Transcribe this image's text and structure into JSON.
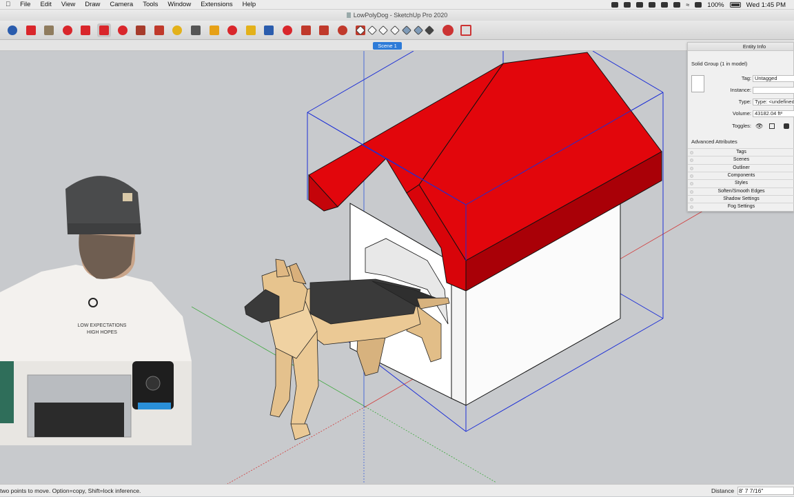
{
  "app": {
    "menu": [
      "File",
      "Edit",
      "View",
      "Draw",
      "Camera",
      "Tools",
      "Window",
      "Extensions",
      "Help"
    ],
    "window_title": "LowPolyDog - SketchUp Pro 2020",
    "status": {
      "battery_pct": "100%",
      "clock": "Wed 1:45 PM"
    }
  },
  "toolbar": {
    "tools": [
      {
        "name": "select-tool",
        "color": "#2a5cad",
        "active": false
      },
      {
        "name": "lasso-select-tool",
        "color": "#d9262b",
        "active": false
      },
      {
        "name": "paint-bucket-tool",
        "color": "#8f7c5e",
        "active": false
      },
      {
        "name": "push-pull-tool",
        "color": "#d9262b",
        "active": false
      },
      {
        "name": "rotate-tool",
        "color": "#d9262b",
        "active": false
      },
      {
        "name": "move-tool",
        "color": "#d9262b",
        "active": true
      },
      {
        "name": "follow-me-tool",
        "color": "#d9262b",
        "active": false
      },
      {
        "name": "offset-tool",
        "color": "#a63b2b",
        "active": false
      },
      {
        "name": "scale-tool",
        "color": "#c0392b",
        "active": false
      },
      {
        "name": "tape-measure-tool",
        "color": "#e3b11a",
        "active": false
      },
      {
        "name": "text-tool",
        "color": "#555555",
        "active": false
      },
      {
        "name": "orbit-tool",
        "color": "#e6a016",
        "active": false
      },
      {
        "name": "pan-tool",
        "color": "#d9262b",
        "active": false
      },
      {
        "name": "hand-tool",
        "color": "#e3b11a",
        "active": false
      },
      {
        "name": "zoom-tool",
        "color": "#2a5cad",
        "active": false
      },
      {
        "name": "zoom-extents-tool",
        "color": "#d9262b",
        "active": false
      },
      {
        "name": "warehouse-tool",
        "color": "#c0392b",
        "active": false
      },
      {
        "name": "extension-tool",
        "color": "#c0392b",
        "active": false
      },
      {
        "name": "component-tool",
        "color": "#c0392b",
        "active": false
      },
      {
        "name": "ruby-tool",
        "color": "#c0392b",
        "active": false
      }
    ],
    "styles": [
      "xray-style",
      "back-edges-style",
      "wireframe-style",
      "hidden-line-style",
      "shaded-style",
      "shaded-textures-style",
      "monochrome-style"
    ],
    "section_tools": [
      "section-plane-tool",
      "display-section-tool"
    ]
  },
  "scene_tab": "Scene 1",
  "entity_info": {
    "title": "Entity Info",
    "selection": "Solid Group (1 in model)",
    "tag_label": "Tag:",
    "tag_value": "Untagged",
    "instance_label": "Instance:",
    "instance_value": "",
    "type_label": "Type:",
    "type_value": "Type: <undefined>",
    "volume_label": "Volume:",
    "volume_value": "43182.04 ft³",
    "toggles_label": "Toggles:",
    "advanced_label": "Advanced Attributes"
  },
  "tray": [
    "Tags",
    "Scenes",
    "Outliner",
    "Components",
    "Styles",
    "Soften/Smooth Edges",
    "Shadow Settings",
    "Fog Settings"
  ],
  "webcam": {
    "shirt_line1": "LOW EXPECTATIONS",
    "shirt_line2": "HIGH HOPES"
  },
  "statusbar": {
    "hint": "two points to move.  Option=copy, Shift=lock inference.",
    "measurement_label": "Distance",
    "measurement_value": "8' 7 7/16\""
  }
}
